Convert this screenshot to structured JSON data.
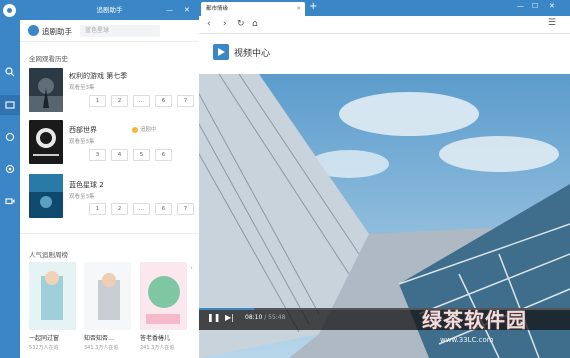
{
  "app": {
    "title": "追剧助手",
    "name": "追剧助手",
    "search_placeholder": "蓝色星球",
    "accent": "#3b86c6"
  },
  "rail": {
    "icons": [
      "app-logo-icon",
      "search-icon",
      "tv-icon",
      "chat-icon",
      "settings-icon",
      "video-icon"
    ]
  },
  "history": {
    "title": "全网观看历史",
    "items": [
      {
        "title": "权利的游戏 第七季",
        "sub": "观看至3集",
        "episodes": [
          "1",
          "2",
          "...",
          "6",
          "7"
        ],
        "status": ""
      },
      {
        "title": "西部世界",
        "sub": "观看至3集",
        "episodes": [
          "3",
          "4",
          "5",
          "6"
        ],
        "status": "追剧中"
      },
      {
        "title": "蓝色星球 2",
        "sub": "观看至3集",
        "episodes": [
          "1",
          "2",
          "...",
          "6",
          "7"
        ],
        "status": ""
      }
    ]
  },
  "ranking": {
    "title": "人气追剧周榜",
    "items": [
      {
        "name": "一起同过窗",
        "count": "532万人在追"
      },
      {
        "name": "知否知否…",
        "count": "341.3万人在追"
      },
      {
        "name": "答老香椿儿",
        "count": "241.3万人在追"
      }
    ]
  },
  "browser": {
    "tab_title": "都市情缘",
    "page_title": "视频中心",
    "current_time": "08:10",
    "duration": "/ 55:48",
    "progress_fraction": 0.147
  },
  "watermark": {
    "text": "绿茶软件园",
    "url": "www.33LC.com"
  }
}
